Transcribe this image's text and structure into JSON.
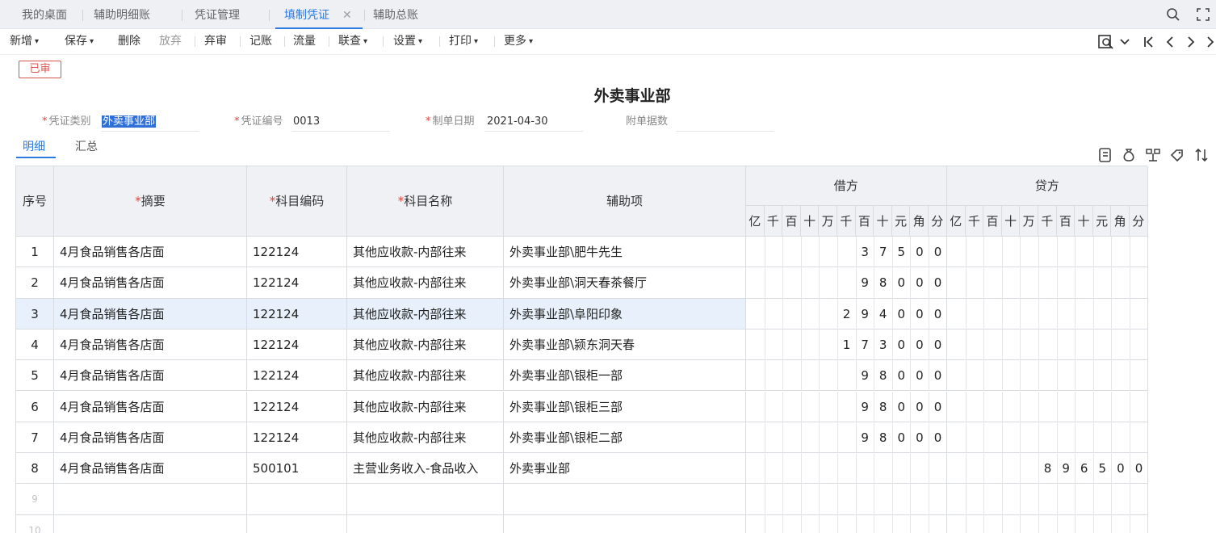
{
  "tabs": [
    {
      "label": "我的桌面",
      "active": false
    },
    {
      "label": "辅助明细账",
      "active": false
    },
    {
      "label": "凭证管理",
      "active": false
    },
    {
      "label": "填制凭证",
      "active": true,
      "closable": true
    },
    {
      "label": "辅助总账",
      "active": false
    }
  ],
  "tab_close_glyph": "✕",
  "toolbar": {
    "items": [
      {
        "label": "新增",
        "dropdown": true,
        "disabled": false
      },
      {
        "label": "保存",
        "dropdown": true,
        "disabled": false
      },
      {
        "label": "删除",
        "dropdown": false,
        "disabled": false
      },
      {
        "label": "放弃",
        "dropdown": false,
        "disabled": true
      },
      {
        "label": "弃审",
        "dropdown": false,
        "disabled": false
      },
      {
        "label": "记账",
        "dropdown": false,
        "disabled": false
      },
      {
        "label": "流量",
        "dropdown": false,
        "disabled": false
      },
      {
        "label": "联查",
        "dropdown": true,
        "disabled": false
      },
      {
        "label": "设置",
        "dropdown": true,
        "disabled": false
      },
      {
        "label": "打印",
        "dropdown": true,
        "disabled": false
      },
      {
        "label": "更多",
        "dropdown": true,
        "disabled": false
      }
    ],
    "caret_glyph": "▾"
  },
  "status_badge": "已审",
  "doc_title": "外卖事业部",
  "header_fields": {
    "voucher_type_label": "凭证类别",
    "voucher_type_value": "外卖事业部",
    "voucher_no_label": "凭证编号",
    "voucher_no_value": "0013",
    "date_label": "制单日期",
    "date_value": "2021-04-30",
    "attachments_label": "附单据数",
    "attachments_value": ""
  },
  "required_mark": "*",
  "subtabs": [
    {
      "label": "明细",
      "active": true
    },
    {
      "label": "汇总",
      "active": false
    }
  ],
  "table": {
    "headers": {
      "seq": "序号",
      "summary": "摘要",
      "account_code": "科目编码",
      "account_name": "科目名称",
      "auxiliary": "辅助项",
      "debit": "借方",
      "credit": "贷方"
    },
    "digit_units": [
      "亿",
      "千",
      "百",
      "十",
      "万",
      "千",
      "百",
      "十",
      "元",
      "角",
      "分"
    ],
    "rows": [
      {
        "seq": "1",
        "summary": "4月食品销售各店面",
        "code": "122124",
        "name": "其他应收款-内部往来",
        "aux": "外卖事业部\\肥牛先生",
        "debit": "37500",
        "credit": ""
      },
      {
        "seq": "2",
        "summary": "4月食品销售各店面",
        "code": "122124",
        "name": "其他应收款-内部往来",
        "aux": "外卖事业部\\洞天春茶餐厅",
        "debit": "98000",
        "credit": ""
      },
      {
        "seq": "3",
        "summary": "4月食品销售各店面",
        "code": "122124",
        "name": "其他应收款-内部往来",
        "aux": "外卖事业部\\阜阳印象",
        "debit": "294000",
        "credit": ""
      },
      {
        "seq": "4",
        "summary": "4月食品销售各店面",
        "code": "122124",
        "name": "其他应收款-内部往来",
        "aux": "外卖事业部\\颍东洞天春",
        "debit": "173000",
        "credit": ""
      },
      {
        "seq": "5",
        "summary": "4月食品销售各店面",
        "code": "122124",
        "name": "其他应收款-内部往来",
        "aux": "外卖事业部\\银柜一部",
        "debit": "98000",
        "credit": ""
      },
      {
        "seq": "6",
        "summary": "4月食品销售各店面",
        "code": "122124",
        "name": "其他应收款-内部往来",
        "aux": "外卖事业部\\银柜三部",
        "debit": "98000",
        "credit": ""
      },
      {
        "seq": "7",
        "summary": "4月食品销售各店面",
        "code": "122124",
        "name": "其他应收款-内部往来",
        "aux": "外卖事业部\\银柜二部",
        "debit": "98000",
        "credit": ""
      },
      {
        "seq": "8",
        "summary": "4月食品销售各店面",
        "code": "500101",
        "name": "主营业务收入-食品收入",
        "aux": "外卖事业部",
        "debit": "",
        "credit": "896500"
      },
      {
        "seq": "9",
        "summary": "",
        "code": "",
        "name": "",
        "aux": "",
        "debit": "",
        "credit": ""
      },
      {
        "seq": "10",
        "summary": "",
        "code": "",
        "name": "",
        "aux": "",
        "debit": "",
        "credit": ""
      }
    ],
    "highlighted_row": 3
  },
  "icons": {
    "search": "search-icon",
    "fullscreen": "fullscreen-icon",
    "preview": "preview-icon",
    "first": "first-page-icon",
    "prev": "prev-icon",
    "next": "next-icon",
    "last": "last-icon"
  },
  "colors": {
    "accent": "#2a7ae2",
    "required": "#e0463c",
    "badge": "#d9534f",
    "header_bg": "#eff1f4",
    "highlight_row": "#e7f0fb"
  }
}
